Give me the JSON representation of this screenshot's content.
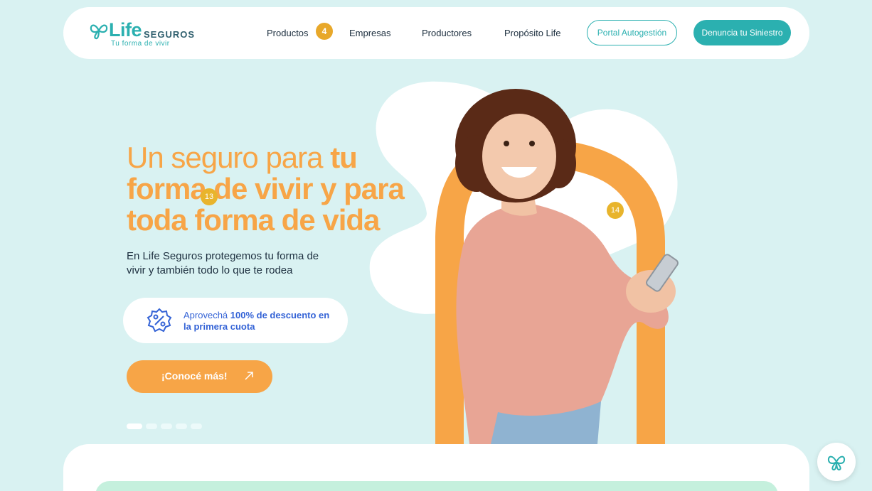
{
  "header": {
    "logo": {
      "brand": "Life",
      "suffix": "SEGUROS",
      "tagline": "Tu forma de vivir"
    },
    "nav": [
      {
        "label": "Productos"
      },
      {
        "label": "Empresas"
      },
      {
        "label": "Productores"
      },
      {
        "label": "Propósito Life"
      }
    ],
    "nav_badge": "4",
    "portal_label": "Portal Autogestión",
    "siniestro_label": "Denuncia tu Siniestro"
  },
  "hero": {
    "title_line1_light": "Un seguro para ",
    "title_line1_bold": "tu",
    "title_line2": "forma de vivir y para",
    "title_line3": "toda forma de vida",
    "subtitle": "En Life Seguros protegemos tu forma de vivir y también todo lo que te rodea",
    "promo_pre": "Aprovechá ",
    "promo_bold": "100% de descuento en la primera cuota",
    "cta_label": "¡Conocé más!",
    "markers": [
      "13",
      "14"
    ],
    "slides_total": 5,
    "slide_active": 1
  },
  "icons": {
    "logo": "butterfly-logo-icon",
    "promo": "discount-percent-icon",
    "cta": "arrow-up-right-icon",
    "chat": "butterfly-chat-icon"
  },
  "colors": {
    "background": "#d9f2f2",
    "teal": "#2bb0b0",
    "orange": "#f7a547",
    "badge": "#e8a82a",
    "promo_blue": "#3463d6",
    "navy_text": "#1d2f3f"
  }
}
